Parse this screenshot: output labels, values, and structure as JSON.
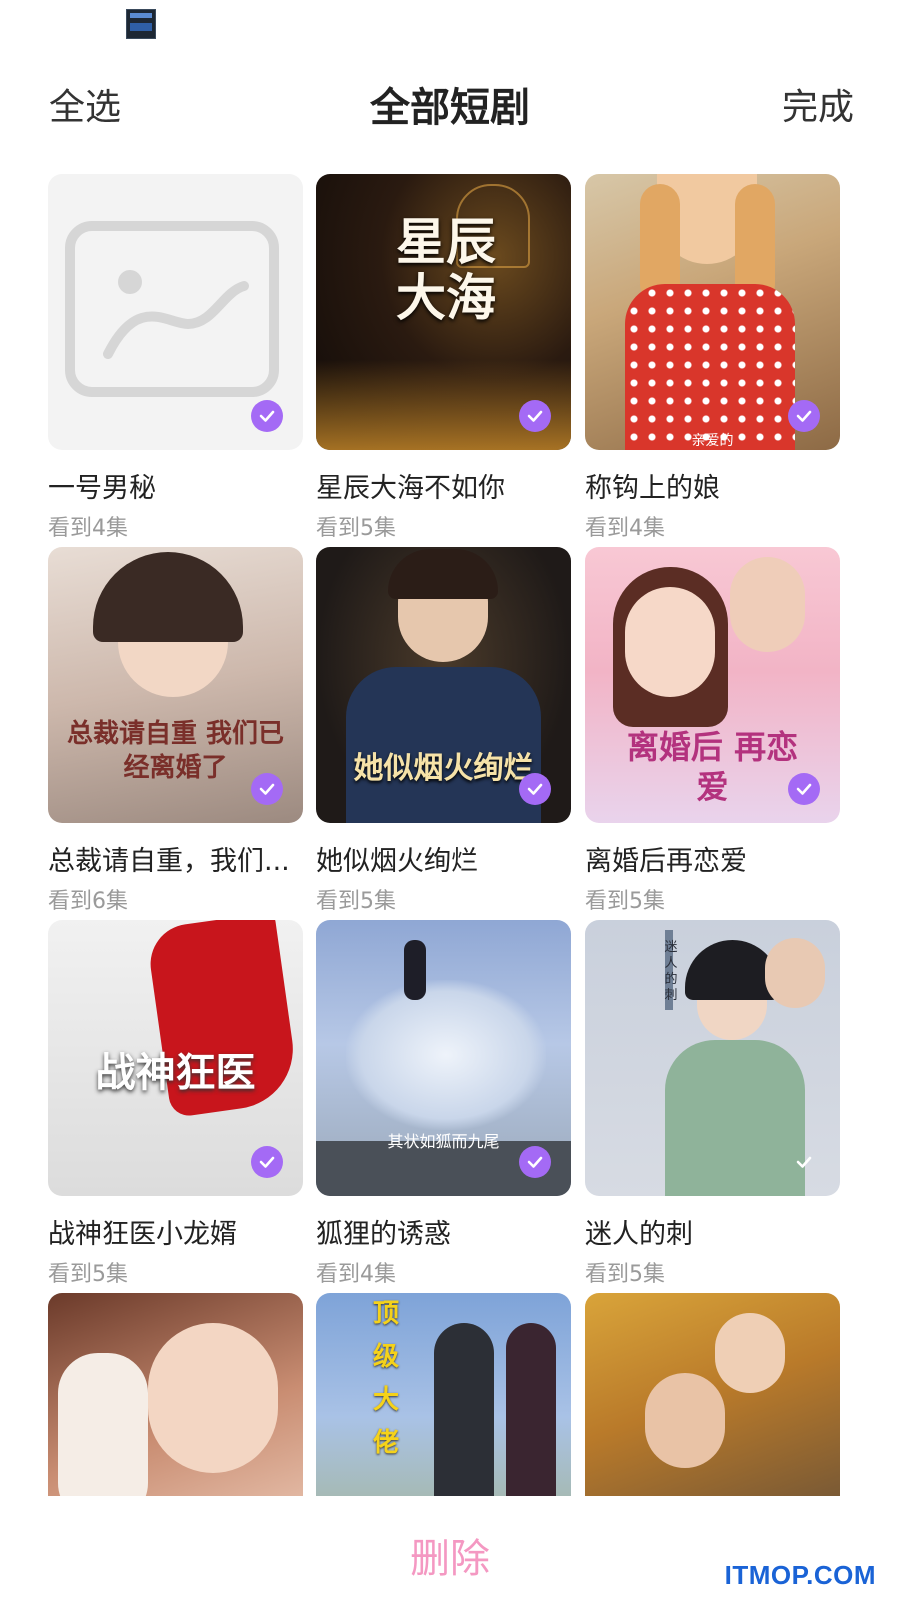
{
  "header": {
    "select_all": "全选",
    "title": "全部短剧",
    "done": "完成"
  },
  "dramas": [
    {
      "title": "一号男秘",
      "progress": "看到4集",
      "selected": true,
      "cover": "placeholder"
    },
    {
      "title": "星辰大海不如你",
      "progress": "看到5集",
      "selected": true,
      "cover": "星辰大海"
    },
    {
      "title": "称钩上的娘",
      "progress": "看到4集",
      "selected": true,
      "cover": "亲爱的"
    },
    {
      "title": "总裁请自重，我们...",
      "progress": "看到6集",
      "selected": true,
      "cover": "总裁请自重 我们已经离婚了"
    },
    {
      "title": "她似烟火绚烂",
      "progress": "看到5集",
      "selected": true,
      "cover": "她似烟火绚烂"
    },
    {
      "title": "离婚后再恋爱",
      "progress": "看到5集",
      "selected": true,
      "cover": "离婚后 再恋爱"
    },
    {
      "title": "战神狂医小龙婿",
      "progress": "看到5集",
      "selected": true,
      "cover": "战神狂医"
    },
    {
      "title": "狐狸的诱惑",
      "progress": "看到4集",
      "selected": true,
      "cover": "其状如狐而九尾"
    },
    {
      "title": "迷人的刺",
      "progress": "看到5集",
      "selected": false,
      "cover": "迷人的刺"
    },
    {
      "title": "",
      "progress": "",
      "selected": false,
      "cover": ""
    },
    {
      "title": "",
      "progress": "",
      "selected": false,
      "cover": "顶级大佬"
    },
    {
      "title": "",
      "progress": "",
      "selected": false,
      "cover": ""
    }
  ],
  "footer": {
    "delete_label": "删除"
  },
  "watermark": "ITMOP.COM",
  "colors": {
    "accent": "#a46af5",
    "delete": "#f498c2",
    "muted_text": "#9a9a9a",
    "watermark": "#1a63d6"
  }
}
